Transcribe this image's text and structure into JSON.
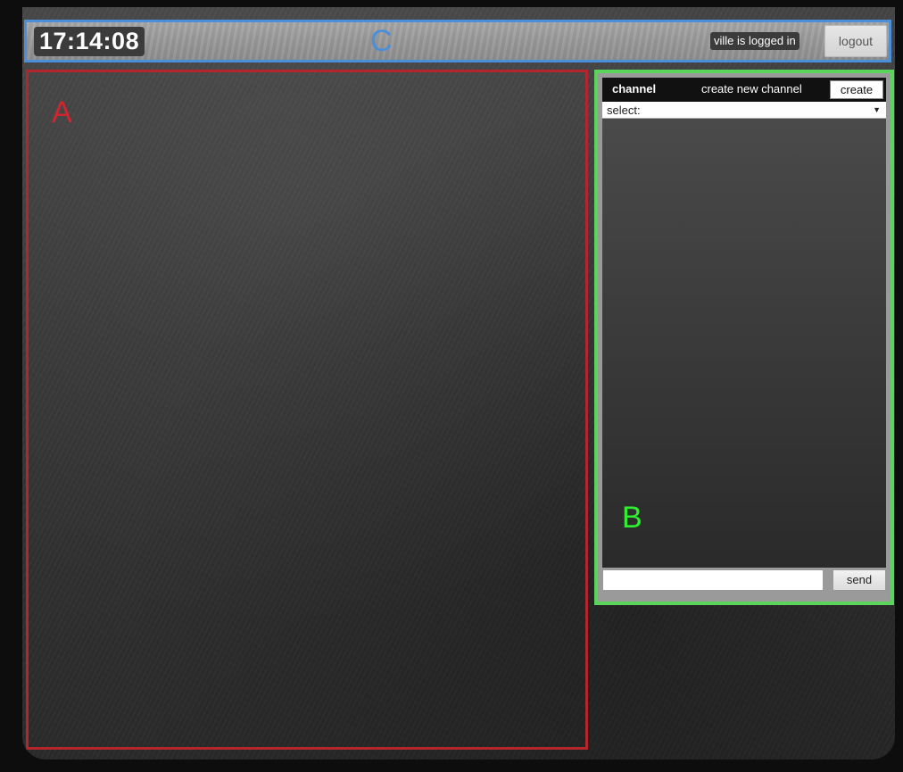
{
  "header": {
    "clock": "17:14:08",
    "zone_label": "C",
    "user_status": "ville is logged in",
    "logout_label": "logout"
  },
  "zone_a": {
    "label": "A"
  },
  "chat": {
    "title": "channel",
    "create_channel_label": "create new channel",
    "create_button_label": "create",
    "select_value": "select:",
    "zone_label": "B",
    "send_label": "send",
    "message_input_value": ""
  },
  "colors": {
    "zone_a_border": "#b4262c",
    "zone_b_border": "#5bd45b",
    "zone_c_border": "#4a8fd8"
  }
}
